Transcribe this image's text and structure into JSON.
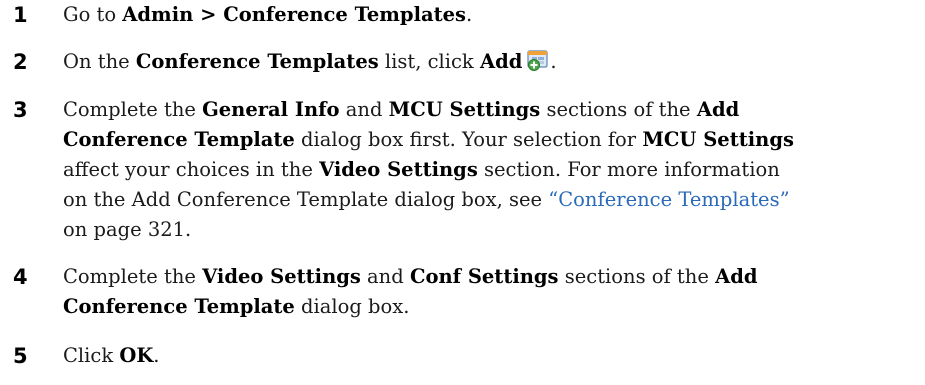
{
  "steps": [
    {
      "number": "1",
      "parts": {
        "a": "Go to ",
        "b1": "Admin > Conference Templates",
        "c": "."
      }
    },
    {
      "number": "2",
      "parts": {
        "a": "On the ",
        "b1": "Conference Templates",
        "c": " list, click ",
        "b2": "Add",
        "d": "."
      },
      "icon": "add-template-icon"
    },
    {
      "number": "3",
      "parts": {
        "a": "Complete the ",
        "b1": "General Info",
        "c": " and ",
        "b2": "MCU Settings",
        "d": " sections of the ",
        "b3": "Add",
        "b4": "Conference Template",
        "e": " dialog box first. Your selection for ",
        "b5": "MCU Settings",
        "f": "affect your choices in the ",
        "b6": "Video Settings",
        "g": " section. For more information",
        "h": "on the Add Conference Template dialog box, see ",
        "link": "“Conference Templates”",
        "i": "on page 321."
      }
    },
    {
      "number": "4",
      "parts": {
        "a": "Complete the ",
        "b1": "Video Settings",
        "c": " and ",
        "b2": "Conf Settings",
        "d": " sections of the ",
        "b3": "Add",
        "b4": "Conference Template",
        "e": " dialog box."
      }
    },
    {
      "number": "5",
      "parts": {
        "a": "Click ",
        "b1": "OK",
        "c": "."
      }
    }
  ],
  "colors": {
    "link": "#2a6ab8",
    "text": "#1a1a1a"
  }
}
